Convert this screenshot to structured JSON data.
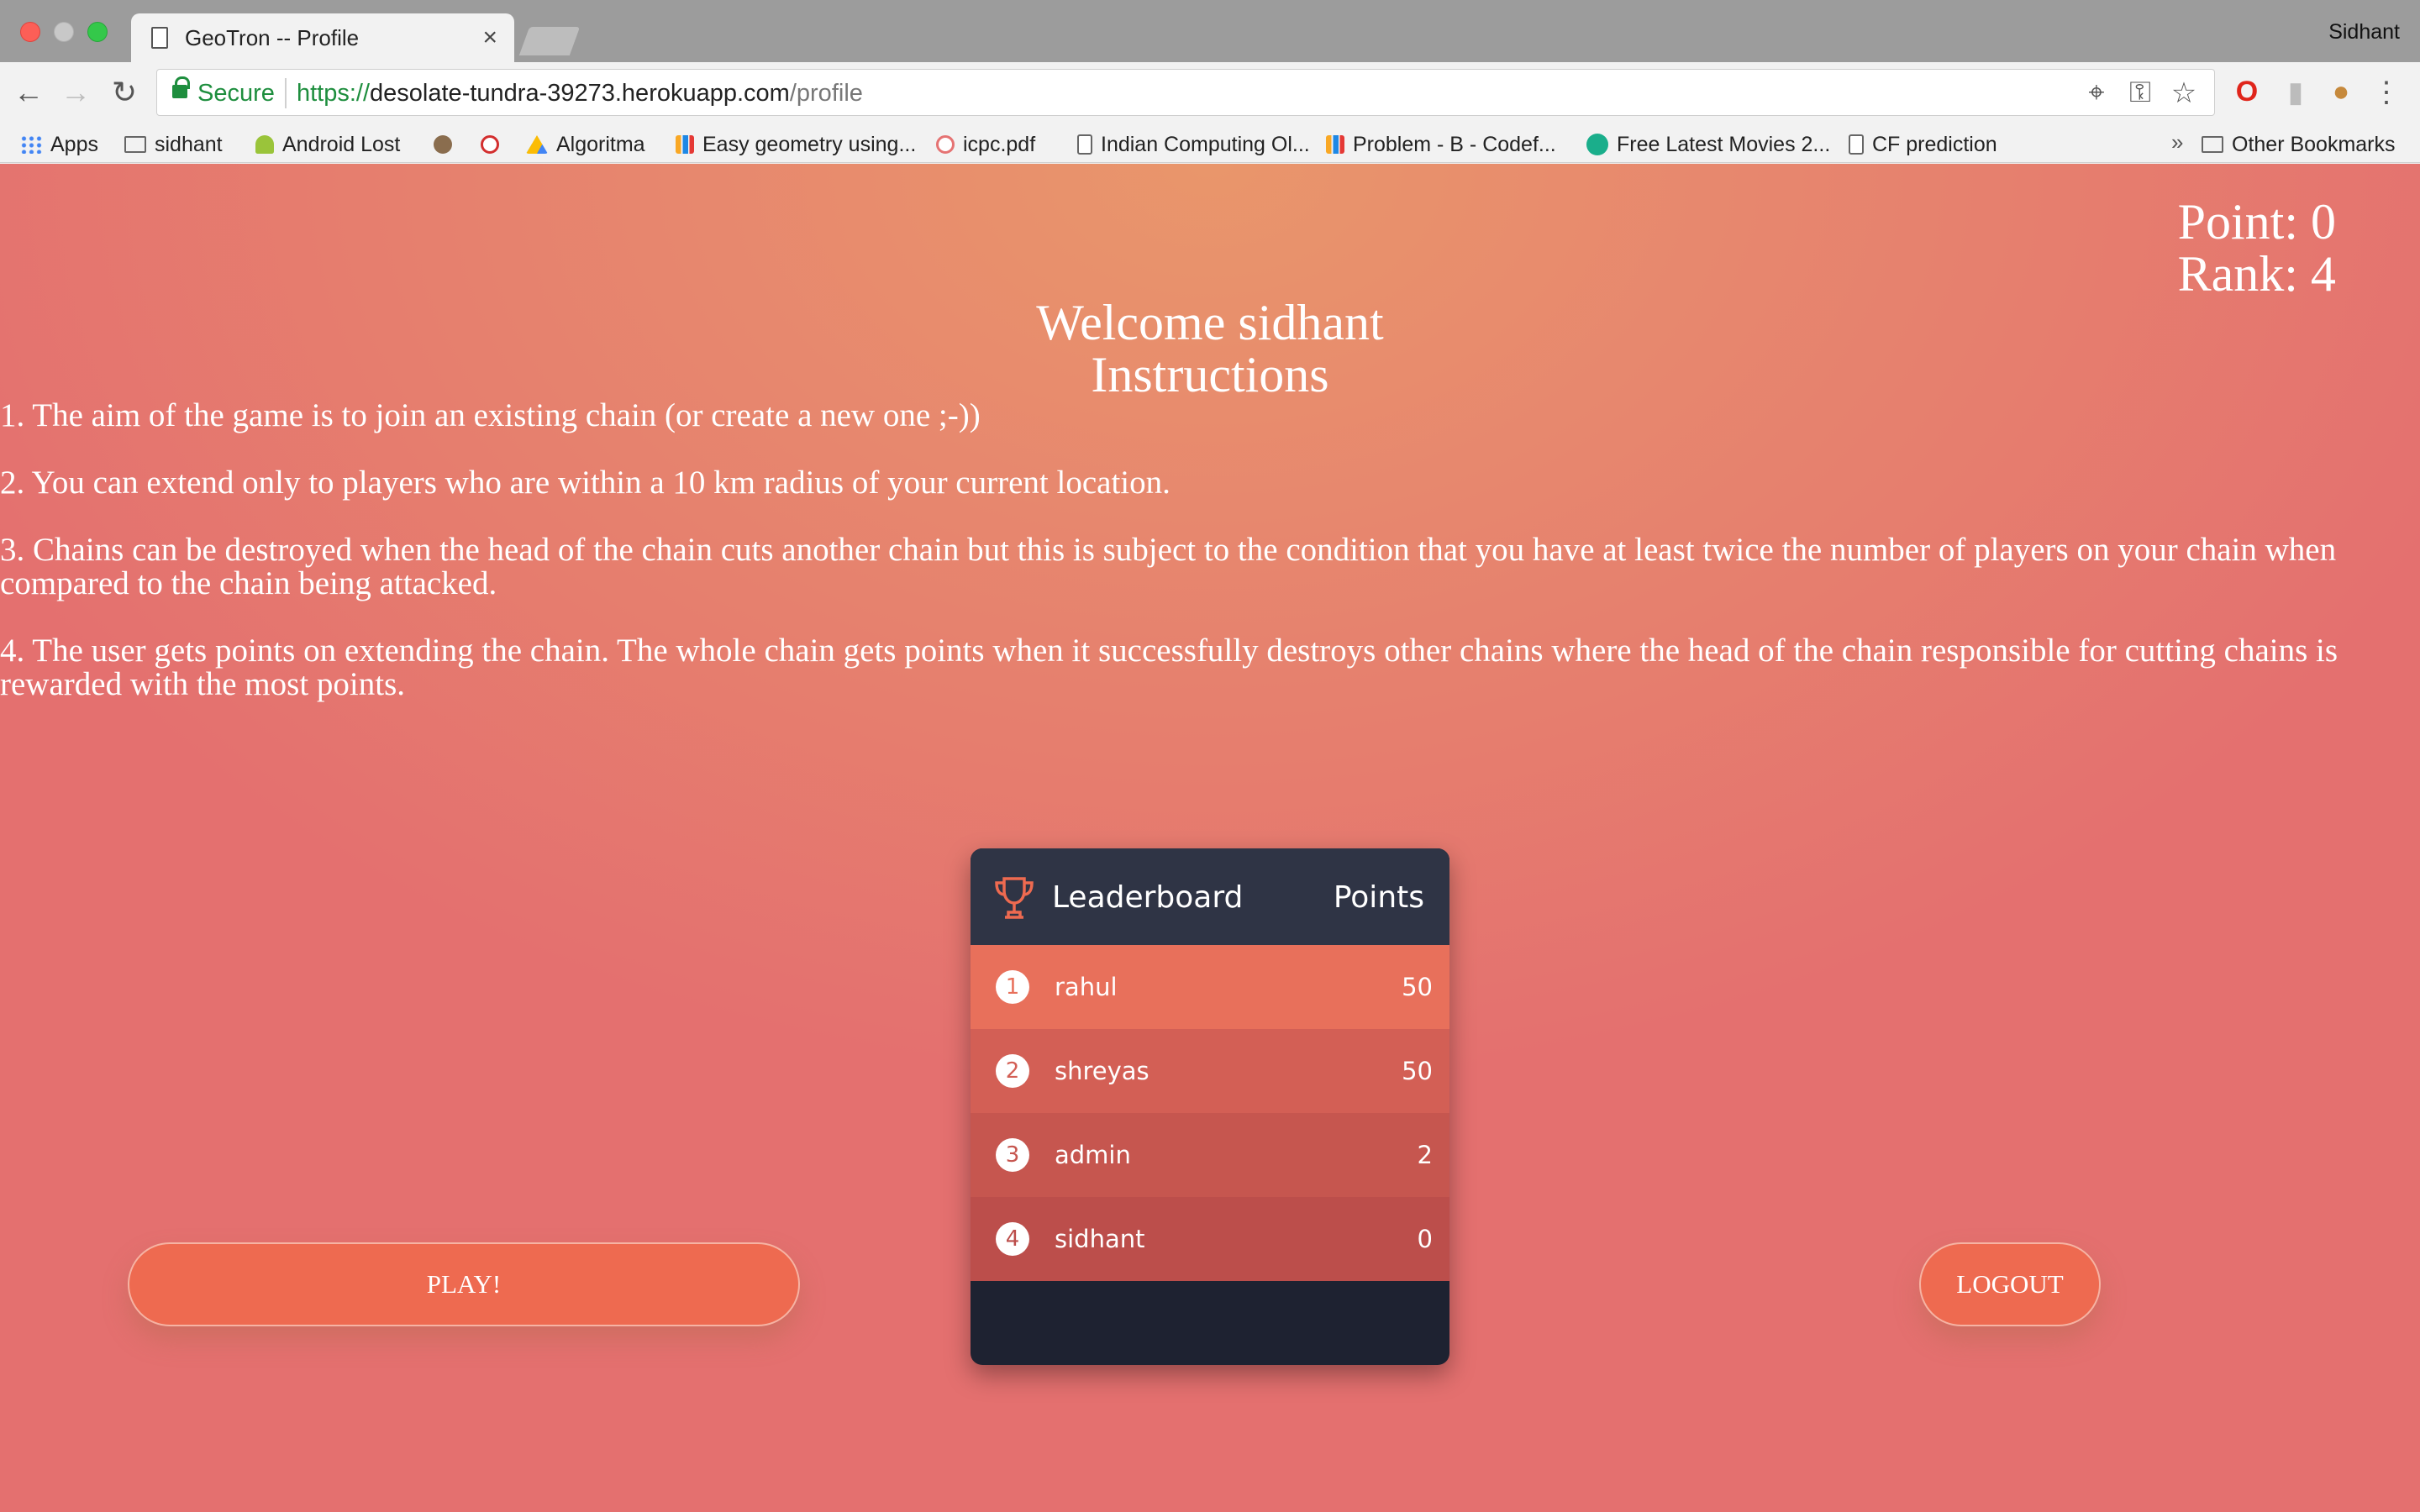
{
  "browser": {
    "tab_title": "GeoTron -- Profile",
    "tab_close": "×",
    "profile_name": "Sidhant",
    "secure_label": "Secure",
    "url_scheme": "https://",
    "url_host": "desolate-tundra-39273.herokuapp.com",
    "url_path": "/profile",
    "bookmarks": [
      {
        "label": "Apps",
        "icon": "apps-grid-icon"
      },
      {
        "label": "sidhant",
        "icon": "folder-icon"
      },
      {
        "label": "Android Lost",
        "icon": "android-icon"
      },
      {
        "label": "",
        "icon": "chip-icon"
      },
      {
        "label": "",
        "icon": "shield-icon"
      },
      {
        "label": "Algoritma",
        "icon": "drive-icon"
      },
      {
        "label": "Easy geometry using...",
        "icon": "bar-chart-icon"
      },
      {
        "label": "icpc.pdf",
        "icon": "pdf-icon"
      },
      {
        "label": "Indian Computing Ol...",
        "icon": "document-icon"
      },
      {
        "label": "Problem - B - Codef...",
        "icon": "bar-chart-icon"
      },
      {
        "label": "Free Latest Movies 2...",
        "icon": "play-icon"
      },
      {
        "label": "CF prediction",
        "icon": "document-icon"
      }
    ],
    "bookmarks_more": "»",
    "other_bookmarks": "Other Bookmarks"
  },
  "stats": {
    "point": "Point: 0",
    "rank": "Rank: 4"
  },
  "welcome": {
    "greeting": "Welcome sidhant",
    "heading": "Instructions"
  },
  "instructions": [
    "1. The aim of the game is to join an existing chain (or create a new one ;-))",
    "2. You can extend only to players who are within a 10 km radius of your current location.",
    "3. Chains can be destroyed when the head of the chain cuts another chain but this is subject to the condition that you have at least twice the number of players on your chain when compared to the chain being attacked.",
    "4. The user gets points on extending the chain. The whole chain gets points when it successfully destroys other chains where the head of the chain responsible for cutting chains is rewarded with the most points."
  ],
  "buttons": {
    "play": "PLAY!",
    "logout": "LOGOUT"
  },
  "leaderboard": {
    "title": "Leaderboard",
    "points_header": "Points",
    "accent": "#ee6a50",
    "rows": [
      {
        "rank": "1",
        "name": "rahul",
        "score": "50",
        "color": "#e8705b"
      },
      {
        "rank": "2",
        "name": "shreyas",
        "score": "50",
        "color": "#d35f55"
      },
      {
        "rank": "3",
        "name": "admin",
        "score": "2",
        "color": "#c6564f"
      },
      {
        "rank": "4",
        "name": "sidhant",
        "score": "0",
        "color": "#bc4e4b"
      }
    ]
  }
}
